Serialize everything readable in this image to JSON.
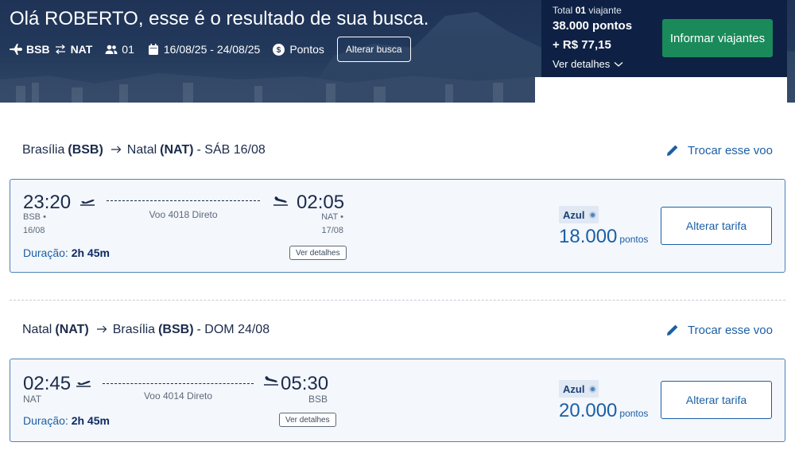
{
  "header": {
    "greeting": "Olá ROBERTO, esse é o resultado de sua busca.",
    "origin": "BSB",
    "destination": "NAT",
    "passengers": "01",
    "dates": "16/08/25 - 24/08/25",
    "payment": "Pontos",
    "alter_search_label": "Alterar busca"
  },
  "summary": {
    "total_prefix": "Total",
    "total_count": "01",
    "total_suffix": "viajante",
    "points": "38.000 pontos",
    "money": "+ R$ 77,15",
    "details_label": "Ver detalhes",
    "inform_button": "Informar viajantes"
  },
  "legs": [
    {
      "from_city": "Brasília",
      "from_code": "(BSB)",
      "to_city": "Natal",
      "to_code": "(NAT)",
      "date": "- SÁB 16/08",
      "change_label": "Trocar esse voo",
      "depart_time": "23:20",
      "depart_airport": "BSB •",
      "depart_date": "16/08",
      "flight": "Voo 4018 Direto",
      "arrive_time": "02:05",
      "arrive_airport": "NAT •",
      "arrive_date": "17/08",
      "duration_label": "Duração:",
      "duration": "2h 45m",
      "details_label": "Ver detalhes",
      "airline": "Azul",
      "price": "18.000",
      "price_unit": "pontos",
      "fare_button": "Alterar tarifa"
    },
    {
      "from_city": "Natal",
      "from_code": "(NAT)",
      "to_city": "Brasília",
      "to_code": "(BSB)",
      "date": "- DOM 24/08",
      "change_label": "Trocar esse voo",
      "depart_time": "02:45",
      "depart_airport": "NAT",
      "flight": "Voo 4014 Direto",
      "arrive_time": "05:30",
      "arrive_airport": "BSB",
      "duration_label": "Duração:",
      "duration": "2h 45m",
      "details_label": "Ver detalhes",
      "airline": "Azul",
      "price": "20.000",
      "price_unit": "pontos",
      "fare_button": "Alterar tarifa"
    }
  ],
  "colors": {
    "header_bg": "#22385a",
    "summary_bg": "#0e2144",
    "primary_green": "#1b8a5a",
    "link_blue": "#1b5fa6",
    "card_border": "#4d82b9"
  }
}
